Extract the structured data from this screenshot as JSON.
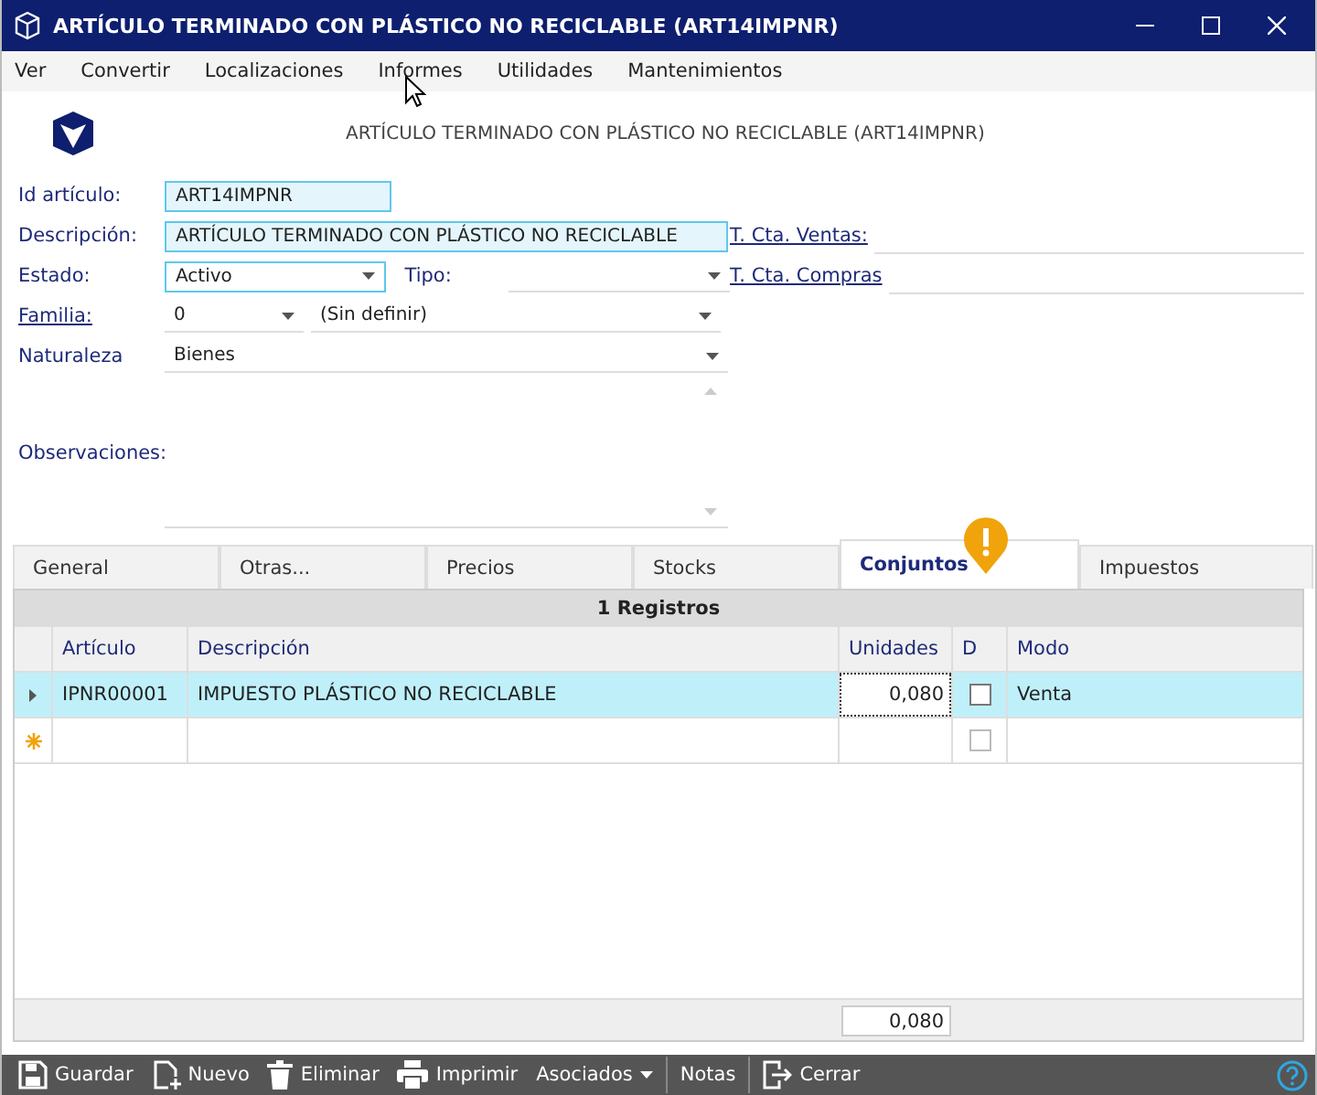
{
  "window": {
    "title": "ARTÍCULO TERMINADO CON PLÁSTICO NO RECICLABLE (ART14IMPNR)"
  },
  "menu": [
    "Ver",
    "Convertir",
    "Localizaciones",
    "Informes",
    "Utilidades",
    "Mantenimientos"
  ],
  "header": {
    "title": "ARTÍCULO TERMINADO CON PLÁSTICO NO RECICLABLE (ART14IMPNR)"
  },
  "form": {
    "id_label": "Id artículo:",
    "id_value": "ART14IMPNR",
    "desc_label": "Descripción:",
    "desc_value": "ARTÍCULO TERMINADO CON PLÁSTICO NO RECICLABLE",
    "estado_label": "Estado:",
    "estado_value": "Activo",
    "tipo_label": "Tipo:",
    "familia_label": "Familia:",
    "familia_code": "0",
    "familia_name": "(Sin definir)",
    "naturaleza_label": "Naturaleza",
    "naturaleza_value": "Bienes",
    "observaciones_label": "Observaciones:",
    "ventas_label": "T. Cta. Ventas:",
    "compras_label": "T. Cta. Compras"
  },
  "tabs": [
    {
      "label": "General",
      "selected": false
    },
    {
      "label": "Otras...",
      "selected": false
    },
    {
      "label": "Precios",
      "selected": false
    },
    {
      "label": "Stocks",
      "selected": false
    },
    {
      "label": "Conjuntos",
      "selected": true
    },
    {
      "label": "Impuestos",
      "selected": false
    }
  ],
  "table": {
    "caption": "1 Registros",
    "columns": [
      "Artículo",
      "Descripción",
      "Unidades",
      "D",
      "Modo"
    ],
    "rows": [
      {
        "articulo": "IPNR00001",
        "descripcion": "IMPUESTO PLÁSTICO NO RECICLABLE",
        "unidades": "0,080",
        "d": false,
        "modo": "Venta",
        "selected": true
      }
    ],
    "new_row": {
      "d": false
    },
    "total": "0,080"
  },
  "toolbar": [
    {
      "label": "Guardar",
      "kind": "save"
    },
    {
      "label": "Nuevo",
      "kind": "new"
    },
    {
      "label": "Eliminar",
      "kind": "delete"
    },
    {
      "label": "Imprimir",
      "kind": "print"
    },
    {
      "label": "Asociados",
      "kind": "dropdown"
    },
    {
      "label": "Notas",
      "kind": "plain"
    },
    {
      "label": "Cerrar",
      "kind": "exit"
    }
  ]
}
